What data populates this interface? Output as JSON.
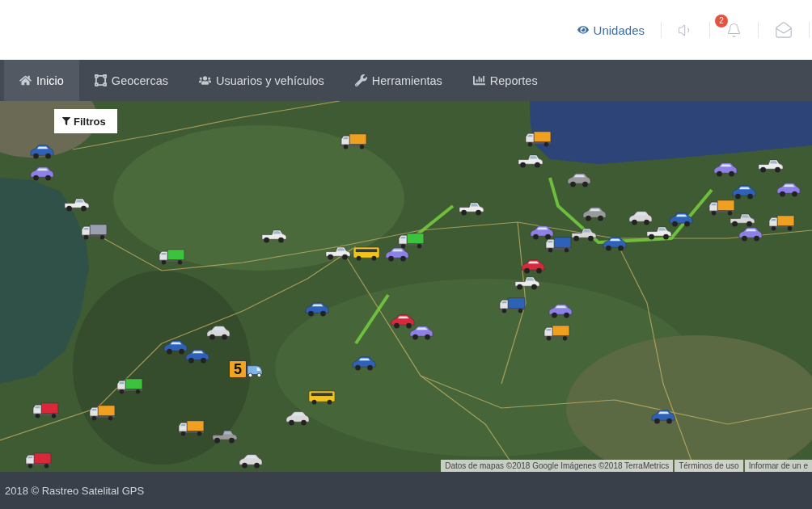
{
  "header": {
    "units_link": {
      "label": "Unidades"
    },
    "notifications": {
      "badge": "2"
    }
  },
  "nav": {
    "tabs": [
      {
        "label": "Inicio",
        "selected": true
      },
      {
        "label": "Geocercas",
        "selected": false
      },
      {
        "label": "Usuarios y vehículos",
        "selected": false
      },
      {
        "label": "Herramientas",
        "selected": false
      },
      {
        "label": "Reportes",
        "selected": false
      }
    ]
  },
  "map": {
    "filter_button": {
      "label": "Filtros"
    },
    "cluster": {
      "count": "5"
    },
    "attribution": {
      "data": "Datos de mapas ©2018 Google Imágenes ©2018 TerraMetrics",
      "terms": "Términos de uso",
      "report": "Informar de un e"
    }
  },
  "footer": {
    "copyright": "2018 © Rastreo Satelital GPS"
  }
}
